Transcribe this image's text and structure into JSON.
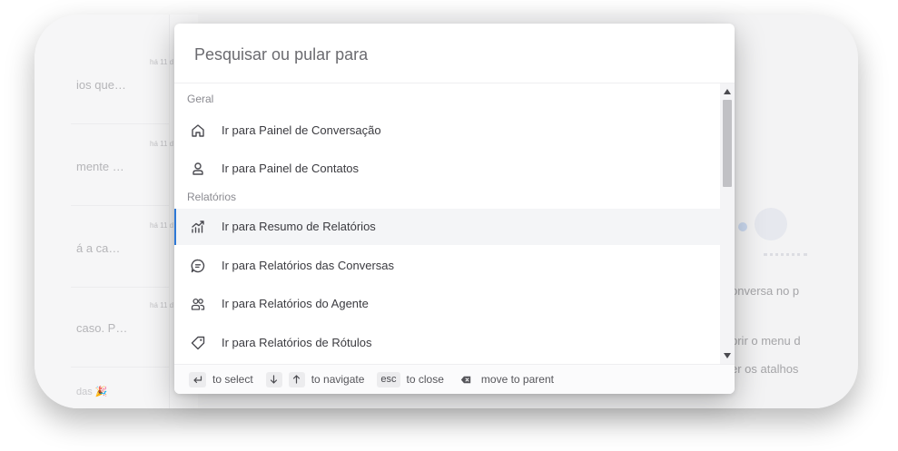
{
  "background": {
    "conversations": [
      {
        "time": "há 11 d",
        "snippet": "ios que…"
      },
      {
        "time": "há 11 d",
        "snippet": "mente …"
      },
      {
        "time": "há 11 d",
        "snippet": "á a ca…"
      },
      {
        "time": "há 11 d",
        "snippet": "caso. P…"
      },
      {
        "snippet": "das 🎉"
      }
    ],
    "right_lines": [
      "onversa no p",
      "brir o menu d",
      "er os atalhos"
    ]
  },
  "palette": {
    "search_placeholder": "Pesquisar ou pular para",
    "search_value": "",
    "sections": [
      {
        "title": "Geral",
        "items": [
          {
            "label": "Ir para Painel de Conversação",
            "icon": "home-icon"
          },
          {
            "label": "Ir para Painel de Contatos",
            "icon": "contact-icon"
          }
        ]
      },
      {
        "title": "Relatórios",
        "items": [
          {
            "label": "Ir para Resumo de Relatórios",
            "icon": "chart-icon",
            "active": true
          },
          {
            "label": "Ir para Relatórios das Conversas",
            "icon": "chat-icon"
          },
          {
            "label": "Ir para Relatórios do Agente",
            "icon": "agents-icon"
          },
          {
            "label": "Ir para Relatórios de Rótulos",
            "icon": "tag-icon"
          }
        ]
      }
    ],
    "footer": {
      "select": {
        "key_icon": "enter-key-icon",
        "text": "to select"
      },
      "navigate": {
        "key_icons": [
          "arrow-down-icon",
          "arrow-up-icon"
        ],
        "text": "to navigate"
      },
      "close": {
        "key": "esc",
        "text": "to close"
      },
      "parent": {
        "key_icon": "backspace-key-icon",
        "text": "move to parent"
      }
    }
  },
  "colors": {
    "accent": "#2e78d6",
    "active_row": "#f4f5f7"
  }
}
